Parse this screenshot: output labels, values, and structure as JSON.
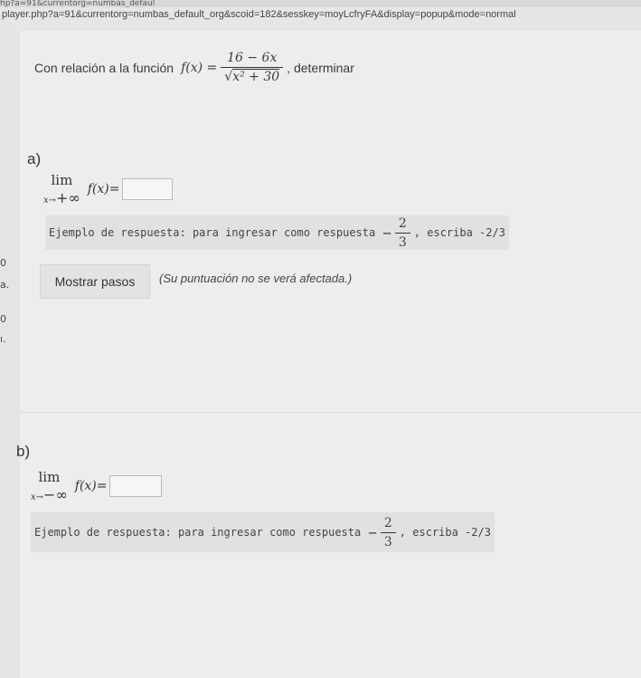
{
  "browser": {
    "top_fragment": "hp?a=91&currentorg=numbas_defaul",
    "url": "player.php?a=91&currentorg=numbas_default_org&scoid=182&sesskey=moyLcfryFA&display=popup&mode=normal"
  },
  "left_strip": {
    "items": [
      "0",
      "a.",
      "0",
      "ı."
    ]
  },
  "question": {
    "prompt": "Con relación a la función",
    "function_name": "f(x) =",
    "numerator": "16 − 6x",
    "denominator_radicand": "x² + 30",
    "suffix": ", determinar"
  },
  "part_a": {
    "label": "a)",
    "lim_word": "lim",
    "lim_sub_var": "x→",
    "lim_sub_inf": "+∞",
    "fx": "f(x)",
    "equals": "=",
    "hint_text": "Ejemplo de respuesta: para ingresar como respuesta",
    "hint_num": "2",
    "hint_den": "3",
    "hint_suffix": ", escriba -2/3",
    "show_steps": "Mostrar pasos",
    "steps_note": "(Su puntuación no se verá afectada.)"
  },
  "part_b": {
    "label": "b)",
    "lim_word": "lim",
    "lim_sub_var": "x→",
    "lim_sub_inf": "−∞",
    "fx": "f(x)",
    "equals": "=",
    "hint_text": "Ejemplo de respuesta: para ingresar como respuesta",
    "hint_num": "2",
    "hint_den": "3",
    "hint_suffix": ", escriba -2/3"
  }
}
